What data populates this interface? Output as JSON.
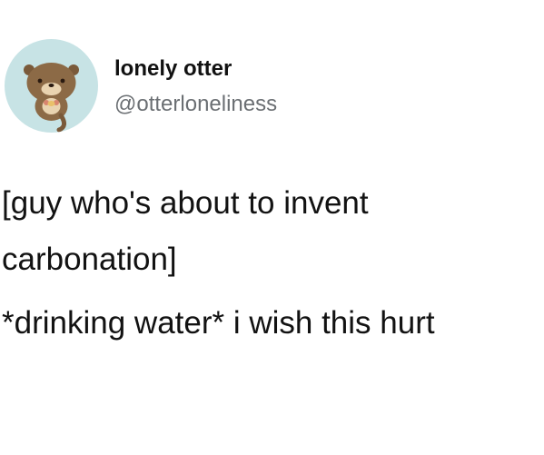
{
  "author": {
    "display_name": "lonely otter",
    "handle": "@otterloneliness",
    "avatar_icon": "otter-avatar-icon",
    "avatar_bg": "#c7e3e5"
  },
  "tweet": {
    "lines": [
      "[guy who's about to invent",
      "carbonation]",
      "*drinking water* i wish this hurt"
    ]
  },
  "colors": {
    "text": "#111111",
    "handle": "#6b6f73",
    "background": "#ffffff"
  }
}
